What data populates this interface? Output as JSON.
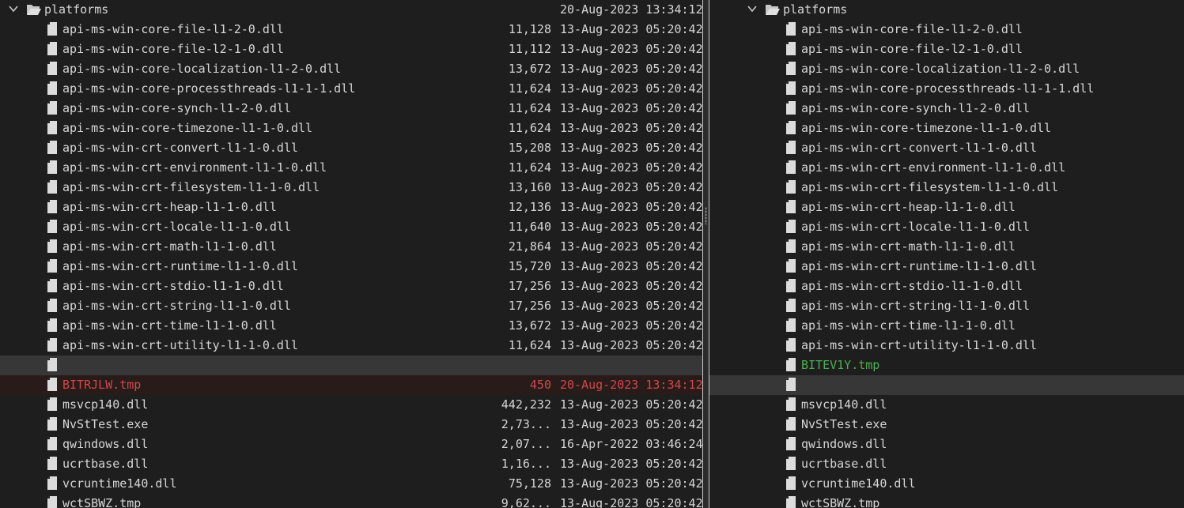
{
  "left": {
    "folder": {
      "name": "platforms",
      "date": "20-Aug-2023 13:34:12"
    },
    "files": [
      {
        "name": "api-ms-win-core-file-l1-2-0.dll",
        "size": "11,128",
        "date": "13-Aug-2023 05:20:42",
        "status": "normal"
      },
      {
        "name": "api-ms-win-core-file-l2-1-0.dll",
        "size": "11,112",
        "date": "13-Aug-2023 05:20:42",
        "status": "normal"
      },
      {
        "name": "api-ms-win-core-localization-l1-2-0.dll",
        "size": "13,672",
        "date": "13-Aug-2023 05:20:42",
        "status": "normal"
      },
      {
        "name": "api-ms-win-core-processthreads-l1-1-1.dll",
        "size": "11,624",
        "date": "13-Aug-2023 05:20:42",
        "status": "normal"
      },
      {
        "name": "api-ms-win-core-synch-l1-2-0.dll",
        "size": "11,624",
        "date": "13-Aug-2023 05:20:42",
        "status": "normal"
      },
      {
        "name": "api-ms-win-core-timezone-l1-1-0.dll",
        "size": "11,624",
        "date": "13-Aug-2023 05:20:42",
        "status": "normal"
      },
      {
        "name": "api-ms-win-crt-convert-l1-1-0.dll",
        "size": "15,208",
        "date": "13-Aug-2023 05:20:42",
        "status": "normal"
      },
      {
        "name": "api-ms-win-crt-environment-l1-1-0.dll",
        "size": "11,624",
        "date": "13-Aug-2023 05:20:42",
        "status": "normal"
      },
      {
        "name": "api-ms-win-crt-filesystem-l1-1-0.dll",
        "size": "13,160",
        "date": "13-Aug-2023 05:20:42",
        "status": "normal"
      },
      {
        "name": "api-ms-win-crt-heap-l1-1-0.dll",
        "size": "12,136",
        "date": "13-Aug-2023 05:20:42",
        "status": "normal"
      },
      {
        "name": "api-ms-win-crt-locale-l1-1-0.dll",
        "size": "11,640",
        "date": "13-Aug-2023 05:20:42",
        "status": "normal"
      },
      {
        "name": "api-ms-win-crt-math-l1-1-0.dll",
        "size": "21,864",
        "date": "13-Aug-2023 05:20:42",
        "status": "normal"
      },
      {
        "name": "api-ms-win-crt-runtime-l1-1-0.dll",
        "size": "15,720",
        "date": "13-Aug-2023 05:20:42",
        "status": "normal"
      },
      {
        "name": "api-ms-win-crt-stdio-l1-1-0.dll",
        "size": "17,256",
        "date": "13-Aug-2023 05:20:42",
        "status": "normal"
      },
      {
        "name": "api-ms-win-crt-string-l1-1-0.dll",
        "size": "17,256",
        "date": "13-Aug-2023 05:20:42",
        "status": "normal"
      },
      {
        "name": "api-ms-win-crt-time-l1-1-0.dll",
        "size": "13,672",
        "date": "13-Aug-2023 05:20:42",
        "status": "normal"
      },
      {
        "name": "api-ms-win-crt-utility-l1-1-0.dll",
        "size": "11,624",
        "date": "13-Aug-2023 05:20:42",
        "status": "normal"
      },
      {
        "name": "",
        "size": "",
        "date": "",
        "status": "placeholder"
      },
      {
        "name": "BITRJLW.tmp",
        "size": "450",
        "date": "20-Aug-2023 13:34:12",
        "status": "deleted"
      },
      {
        "name": "msvcp140.dll",
        "size": "442,232",
        "date": "13-Aug-2023 05:20:42",
        "status": "normal"
      },
      {
        "name": "NvStTest.exe",
        "size": "2,73...",
        "date": "13-Aug-2023 05:20:42",
        "status": "normal"
      },
      {
        "name": "qwindows.dll",
        "size": "2,07...",
        "date": "16-Apr-2022 03:46:24",
        "status": "normal"
      },
      {
        "name": "ucrtbase.dll",
        "size": "1,16...",
        "date": "13-Aug-2023 05:20:42",
        "status": "normal"
      },
      {
        "name": "vcruntime140.dll",
        "size": "75,128",
        "date": "13-Aug-2023 05:20:42",
        "status": "normal"
      },
      {
        "name": "wctSBWZ.tmp",
        "size": "9,62...",
        "date": "13-Aug-2023 05:20:42",
        "status": "normal"
      }
    ]
  },
  "right": {
    "folder": {
      "name": "platforms"
    },
    "files": [
      {
        "name": "api-ms-win-core-file-l1-2-0.dll",
        "status": "normal"
      },
      {
        "name": "api-ms-win-core-file-l2-1-0.dll",
        "status": "normal"
      },
      {
        "name": "api-ms-win-core-localization-l1-2-0.dll",
        "status": "normal"
      },
      {
        "name": "api-ms-win-core-processthreads-l1-1-1.dll",
        "status": "normal"
      },
      {
        "name": "api-ms-win-core-synch-l1-2-0.dll",
        "status": "normal"
      },
      {
        "name": "api-ms-win-core-timezone-l1-1-0.dll",
        "status": "normal"
      },
      {
        "name": "api-ms-win-crt-convert-l1-1-0.dll",
        "status": "normal"
      },
      {
        "name": "api-ms-win-crt-environment-l1-1-0.dll",
        "status": "normal"
      },
      {
        "name": "api-ms-win-crt-filesystem-l1-1-0.dll",
        "status": "normal"
      },
      {
        "name": "api-ms-win-crt-heap-l1-1-0.dll",
        "status": "normal"
      },
      {
        "name": "api-ms-win-crt-locale-l1-1-0.dll",
        "status": "normal"
      },
      {
        "name": "api-ms-win-crt-math-l1-1-0.dll",
        "status": "normal"
      },
      {
        "name": "api-ms-win-crt-runtime-l1-1-0.dll",
        "status": "normal"
      },
      {
        "name": "api-ms-win-crt-stdio-l1-1-0.dll",
        "status": "normal"
      },
      {
        "name": "api-ms-win-crt-string-l1-1-0.dll",
        "status": "normal"
      },
      {
        "name": "api-ms-win-crt-time-l1-1-0.dll",
        "status": "normal"
      },
      {
        "name": "api-ms-win-crt-utility-l1-1-0.dll",
        "status": "normal"
      },
      {
        "name": "BITEV1Y.tmp",
        "status": "added"
      },
      {
        "name": "",
        "status": "placeholder"
      },
      {
        "name": "msvcp140.dll",
        "status": "normal"
      },
      {
        "name": "NvStTest.exe",
        "status": "normal"
      },
      {
        "name": "qwindows.dll",
        "status": "normal"
      },
      {
        "name": "ucrtbase.dll",
        "status": "normal"
      },
      {
        "name": "vcruntime140.dll",
        "status": "normal"
      },
      {
        "name": "wctSBWZ.tmp",
        "status": "normal"
      }
    ]
  },
  "icons": {
    "expand": "chevron-down-icon",
    "folder": "folder-open-icon",
    "file": "file-icon"
  },
  "colors": {
    "deleted": "#d04848",
    "added": "#4caf50",
    "placeholder_row": "#373737"
  }
}
